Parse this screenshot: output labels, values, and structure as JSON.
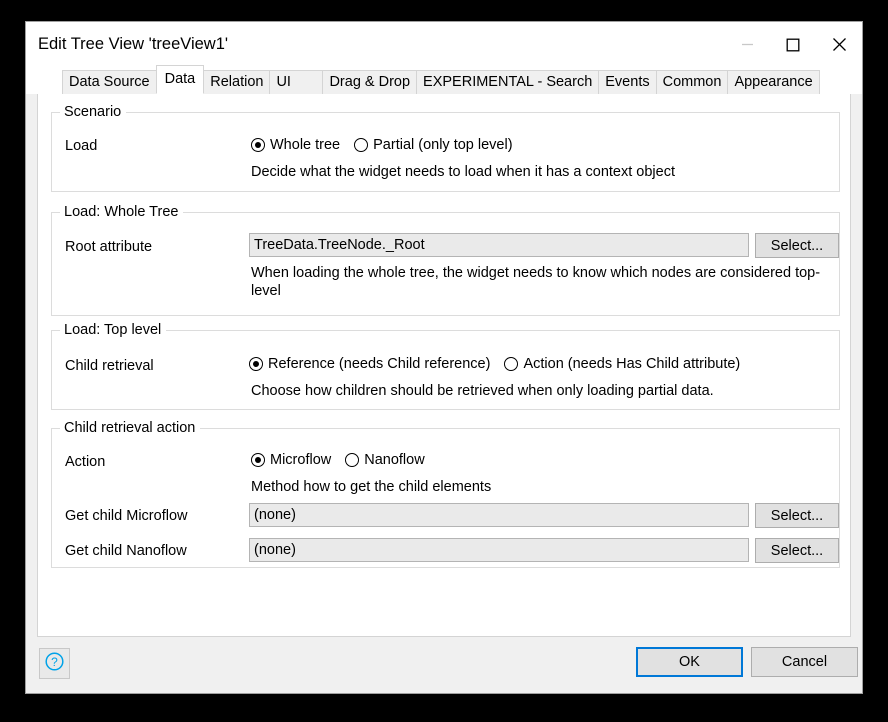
{
  "window": {
    "title": "Edit Tree View 'treeView1'",
    "controls": {
      "minimize": "minimize-icon",
      "maximize": "maximize-icon",
      "close": "close-icon"
    }
  },
  "tabs": [
    {
      "label": "Data Source",
      "selected": false
    },
    {
      "label": "Data",
      "selected": true
    },
    {
      "label": "Relation",
      "selected": false
    },
    {
      "label": "UI",
      "selected": false
    },
    {
      "label": "Drag & Drop",
      "selected": false
    },
    {
      "label": "EXPERIMENTAL - Search",
      "selected": false
    },
    {
      "label": "Events",
      "selected": false
    },
    {
      "label": "Common",
      "selected": false
    },
    {
      "label": "Appearance",
      "selected": false
    }
  ],
  "groups": {
    "scenario": {
      "title": "Scenario",
      "load_label": "Load",
      "options": [
        {
          "label": "Whole tree",
          "checked": true
        },
        {
          "label": "Partial (only top level)",
          "checked": false
        }
      ],
      "hint": "Decide what the widget needs to load when it has a context object"
    },
    "load_whole_tree": {
      "title": "Load: Whole Tree",
      "root_attribute_label": "Root attribute",
      "root_attribute_value": "TreeData.TreeNode._Root",
      "select_label": "Select...",
      "hint": "When loading the whole tree, the widget needs to know which nodes are considered top-level"
    },
    "load_top_level": {
      "title": "Load: Top level",
      "child_retrieval_label": "Child retrieval",
      "options": [
        {
          "label": "Reference (needs Child reference)",
          "checked": true
        },
        {
          "label": "Action (needs Has Child attribute)",
          "checked": false
        }
      ],
      "hint": "Choose how children should be retrieved when only loading partial data."
    },
    "child_retrieval_action": {
      "title": "Child retrieval action",
      "action_label": "Action",
      "options": [
        {
          "label": "Microflow",
          "checked": true
        },
        {
          "label": "Nanoflow",
          "checked": false
        }
      ],
      "hint": "Method how to get the child elements",
      "microflow_label": "Get child Microflow",
      "microflow_value": "(none)",
      "microflow_select_label": "Select...",
      "nanoflow_label": "Get child Nanoflow",
      "nanoflow_value": "(none)",
      "nanoflow_select_label": "Select..."
    }
  },
  "footer": {
    "help_icon": "help-circle-icon",
    "ok_label": "OK",
    "cancel_label": "Cancel"
  },
  "colors": {
    "accent": "#0078d7",
    "help_icon": "#00a2e8",
    "dialog_bg": "#f0f0f0",
    "panel_bg": "#ffffff"
  }
}
